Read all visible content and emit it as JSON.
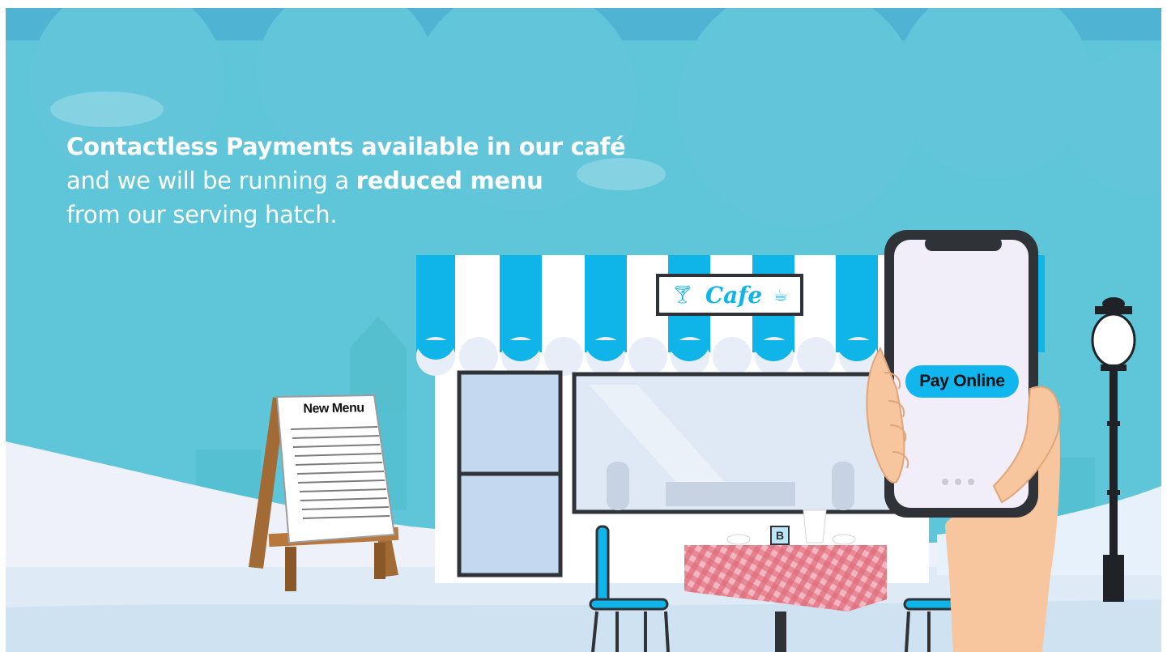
{
  "headline": {
    "line1": "Contactless Payments available in our café",
    "line2_prefix": "and we will be running a ",
    "line2_bold": "reduced menu",
    "line3": "from our serving hatch."
  },
  "cafe_sign": "Cafe",
  "menu_board_title": "New Menu",
  "phone_button_label": "Pay Online",
  "table_card_letter": "B",
  "colors": {
    "sky": "#5fc6d9",
    "cloud": "#6dcde0",
    "awning_blue": "#0fb5e8",
    "button_blue": "#12b6ef",
    "frame_dark": "#2f3338",
    "ground": "#dfeaf7",
    "tablecloth_red": "#e06a7a"
  },
  "icons": [
    "cocktail-glass-icon",
    "coffee-cup-icon",
    "lamp-post-icon"
  ]
}
